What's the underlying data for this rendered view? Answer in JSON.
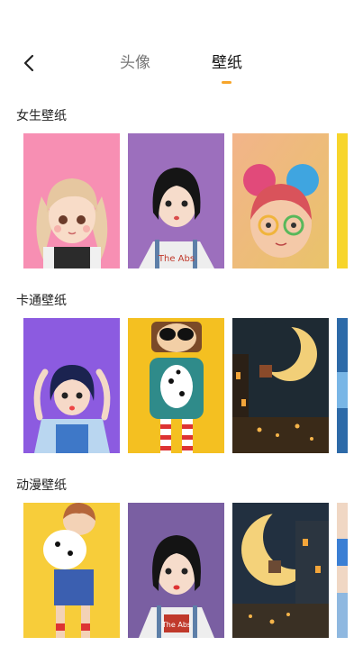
{
  "nav": {
    "back_icon": "chevron-left-icon",
    "tabs": [
      {
        "label": "头像",
        "active": false
      },
      {
        "label": "壁纸",
        "active": true
      }
    ],
    "accent_color": "#f7a52a"
  },
  "sections": [
    {
      "title": "女生壁纸",
      "items": [
        "girl-blonde-pigtails",
        "girl-black-bob-tshirt",
        "girl-colorful-glasses",
        "yellow-partial"
      ]
    },
    {
      "title": "卡通壁纸",
      "items": [
        "girl-overalls-purple",
        "boy-holding-dalmatian",
        "moon-night-city",
        "blue-partial"
      ]
    },
    {
      "title": "动漫壁纸",
      "items": [
        "girl-dalmatian-yellow",
        "girl-black-bob-purple",
        "crescent-moon-town",
        "anime-partial"
      ]
    }
  ],
  "texts": {
    "abs_label": "The Abs"
  }
}
